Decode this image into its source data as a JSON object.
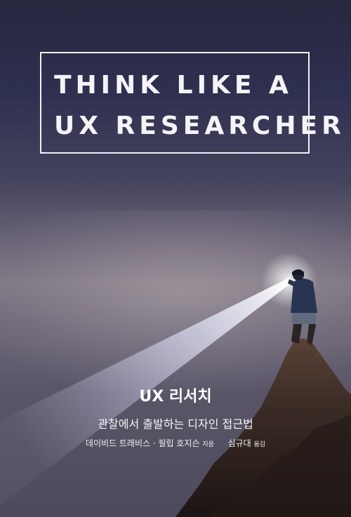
{
  "cover": {
    "title_line1": "THINK LIKE A",
    "title_line2": "UX RESEARCHER",
    "book_title": "UX 리서치",
    "subtitle": "관찰에서 출발하는 디자인 접근법",
    "authors": "데이비드 트래비스 · 필립 호지슨",
    "authors_role": "지음",
    "translator": "심규대",
    "translator_role": "옮김"
  },
  "colors": {
    "sky_top": "#26283f",
    "haze": "#807884",
    "beam": "#eef0ff",
    "rock": "#2b201c",
    "text": "#ffffff"
  }
}
